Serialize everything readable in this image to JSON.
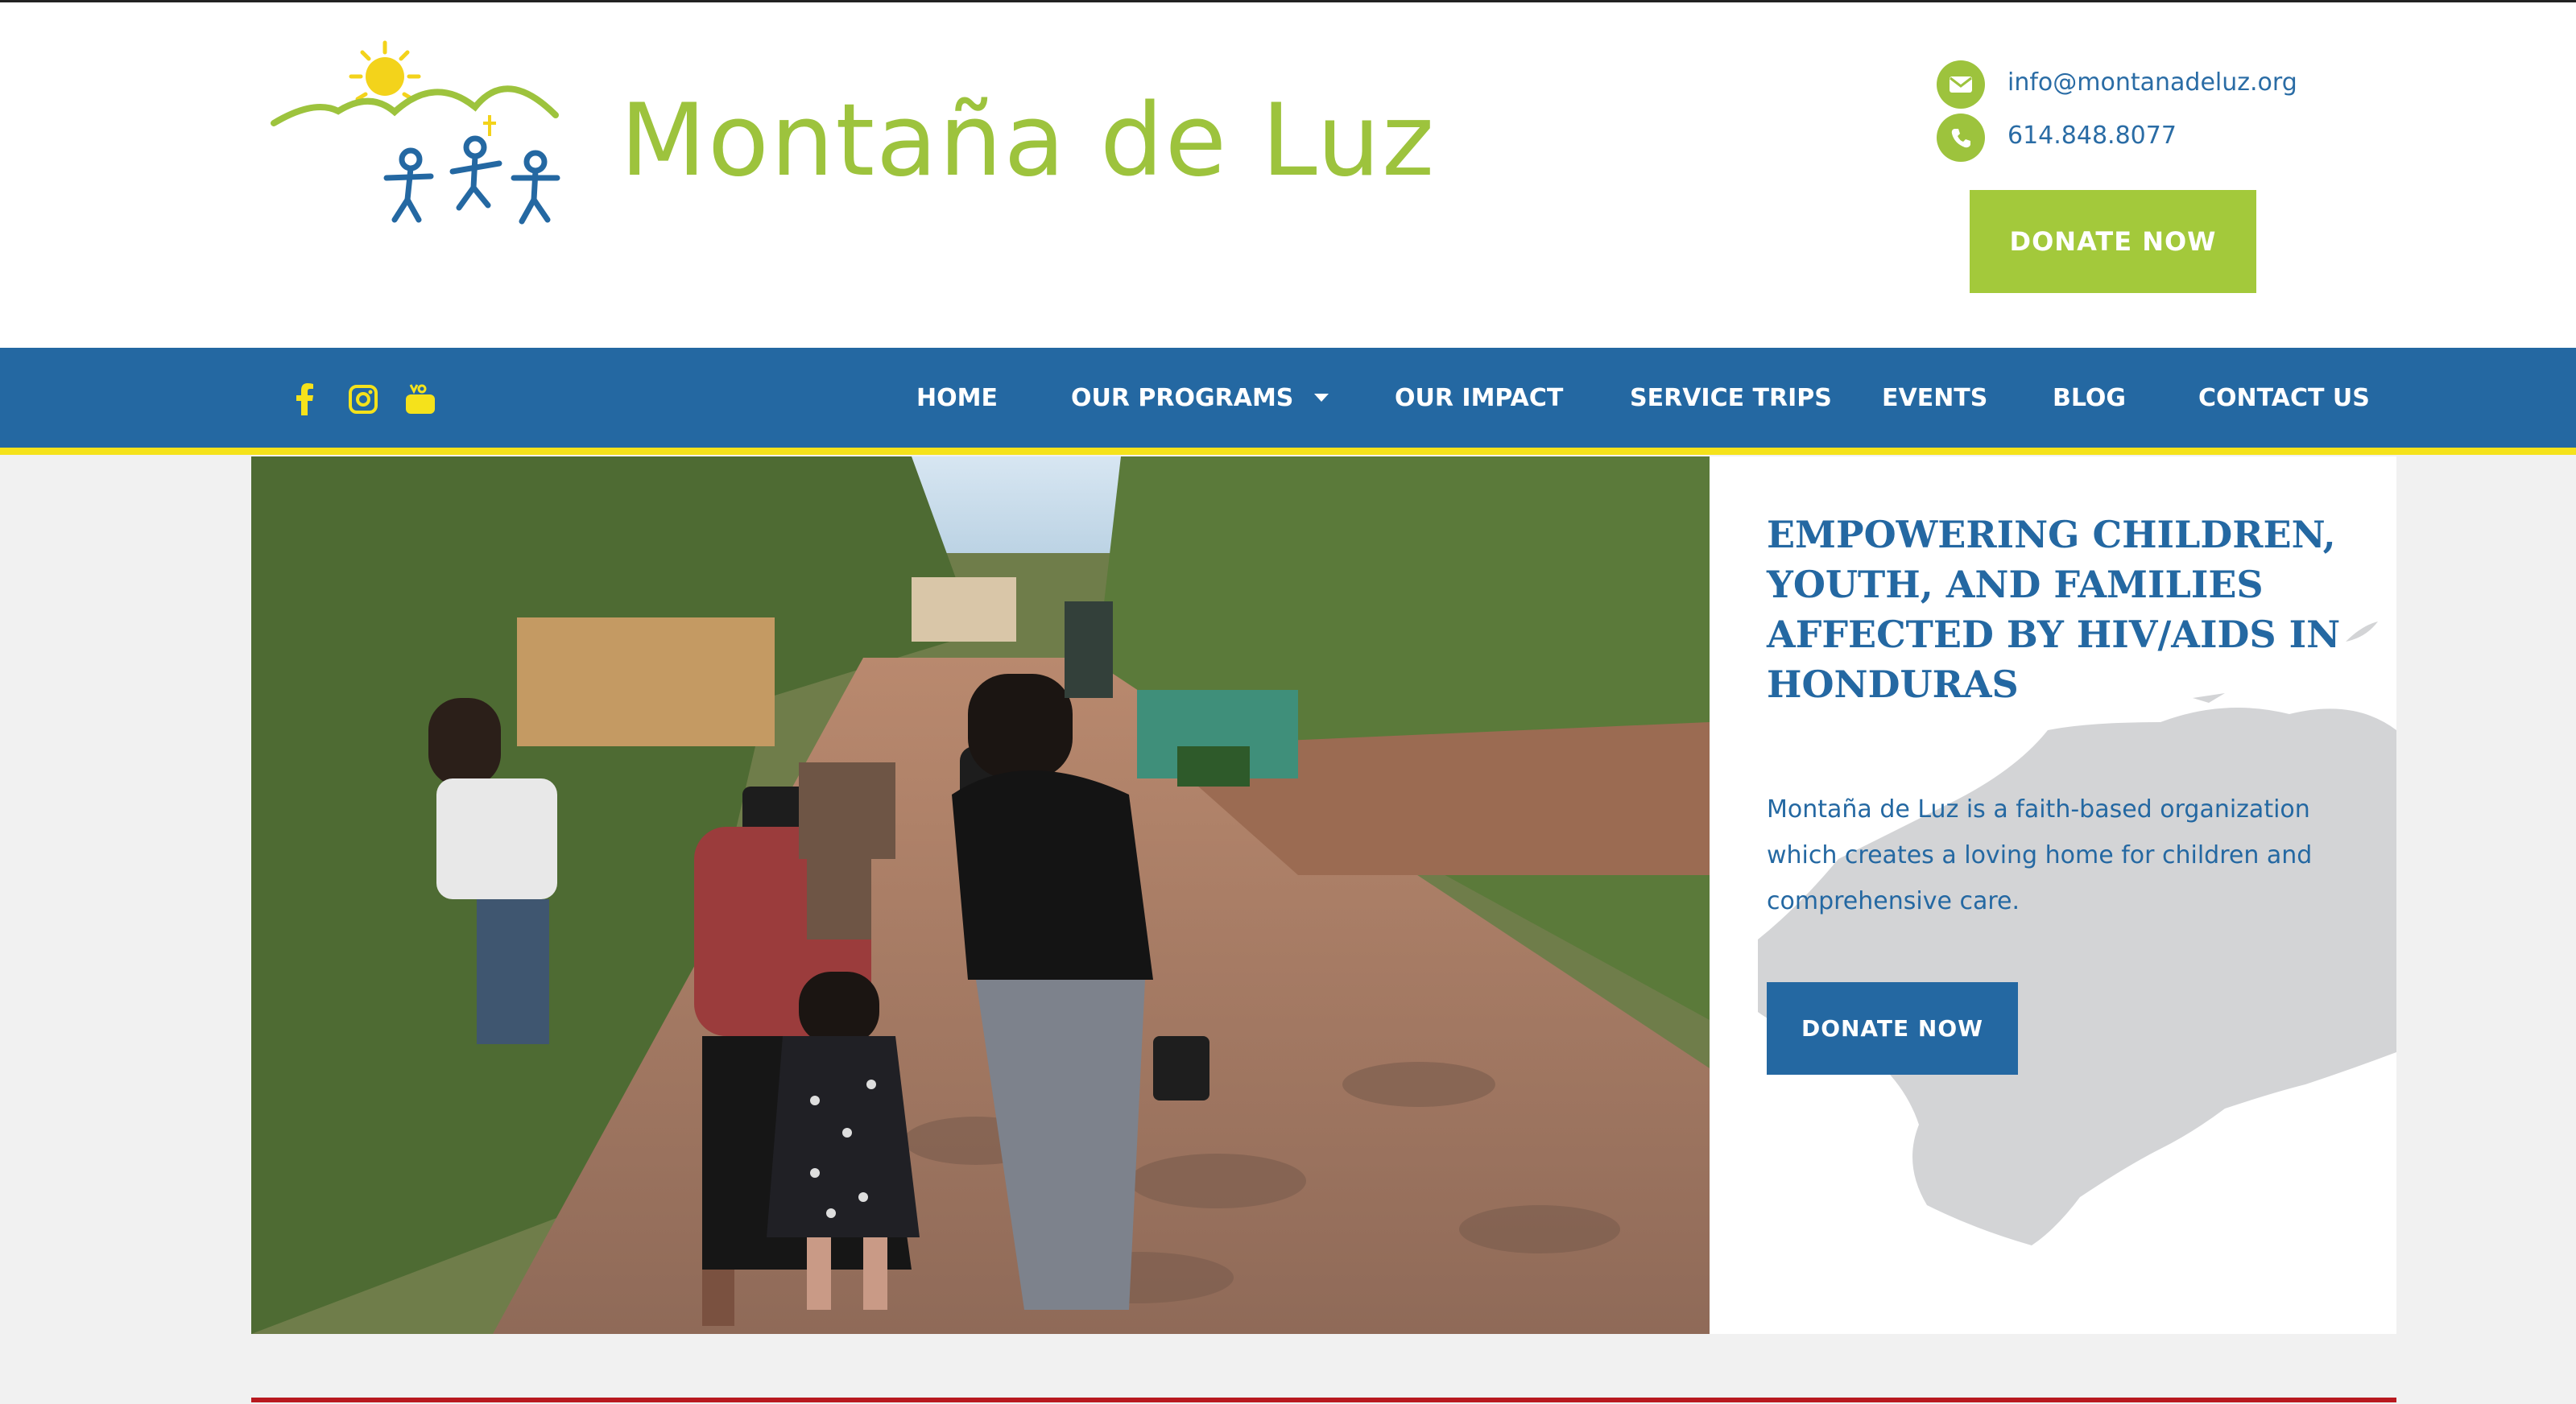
{
  "header": {
    "logo_text": "Montaña de Luz",
    "email": "info@montanadeluz.org",
    "phone": "614.848.8077",
    "donate_label": "DONATE NOW"
  },
  "nav": {
    "social": [
      "facebook-icon",
      "instagram-icon",
      "youtube-icon"
    ],
    "items": [
      {
        "label": "HOME"
      },
      {
        "label": "OUR PROGRAMS"
      },
      {
        "label": "OUR IMPACT"
      },
      {
        "label": "SERVICE TRIPS"
      },
      {
        "label": "EVENTS"
      },
      {
        "label": "BLOG"
      },
      {
        "label": "CONTACT US"
      }
    ]
  },
  "hero": {
    "title": "EMPOWERING CHILDREN, YOUTH, AND FAMILIES AFFECTED BY HIV/AIDS IN HONDURAS",
    "description": "Montaña de Luz is a faith-based organization which creates a loving home for children and comprehensive care.",
    "donate_label": "DONATE NOW"
  },
  "colors": {
    "brand_green": "#9dc33d",
    "nav_blue": "#2468a2",
    "accent_yellow": "#f5e21b",
    "footer_red": "#b8191f"
  }
}
